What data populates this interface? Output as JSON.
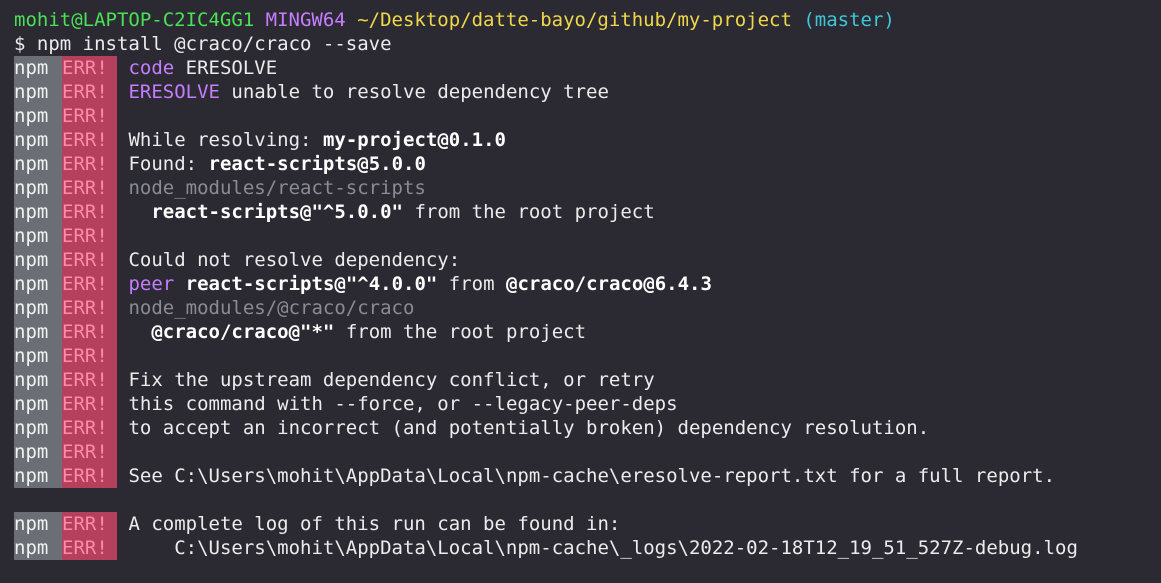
{
  "title_line": {
    "user": "mohit@LAPTOP-C2IC4GG1",
    "env": "MINGW64",
    "path": "~/Desktop/datte-bayo/github/my-project",
    "branch": "(master)"
  },
  "command": {
    "prompt": "$",
    "text": "npm install @craco/craco --save"
  },
  "npm_label": "npm",
  "err_label": "ERR!",
  "log": {
    "code_kw": "code",
    "code_val": "ERESOLVE",
    "eresolve_kw": "ERESOLVE",
    "eresolve_msg": "unable to resolve dependency tree",
    "resolving_label": "While resolving:",
    "resolving_pkg": "my-project@0.1.0",
    "found_label": "Found:",
    "found_pkg": "react-scripts@5.0.0",
    "nm_react_scripts": "node_modules/react-scripts",
    "rs_pkg": "react-scripts@\"^5.0.0\"",
    "rs_from": "from the root project",
    "could_not": "Could not resolve dependency:",
    "peer_kw": "peer",
    "peer_pkg": "react-scripts@\"^4.0.0\"",
    "peer_from": "from",
    "peer_src": "@craco/craco@6.4.3",
    "nm_craco": "node_modules/@craco/craco",
    "craco_pkg": "@craco/craco@\"*\"",
    "craco_from": "from the root project",
    "fix_1": "Fix the upstream dependency conflict, or retry",
    "fix_2": "this command with --force, or --legacy-peer-deps",
    "fix_3": "to accept an incorrect (and potentially broken) dependency resolution.",
    "see_report": "See C:\\Users\\mohit\\AppData\\Local\\npm-cache\\eresolve-report.txt for a full report.",
    "complete_log": "A complete log of this run can be found in:",
    "log_path": "C:\\Users\\mohit\\AppData\\Local\\npm-cache\\_logs\\2022-02-18T12_19_51_527Z-debug.log"
  }
}
